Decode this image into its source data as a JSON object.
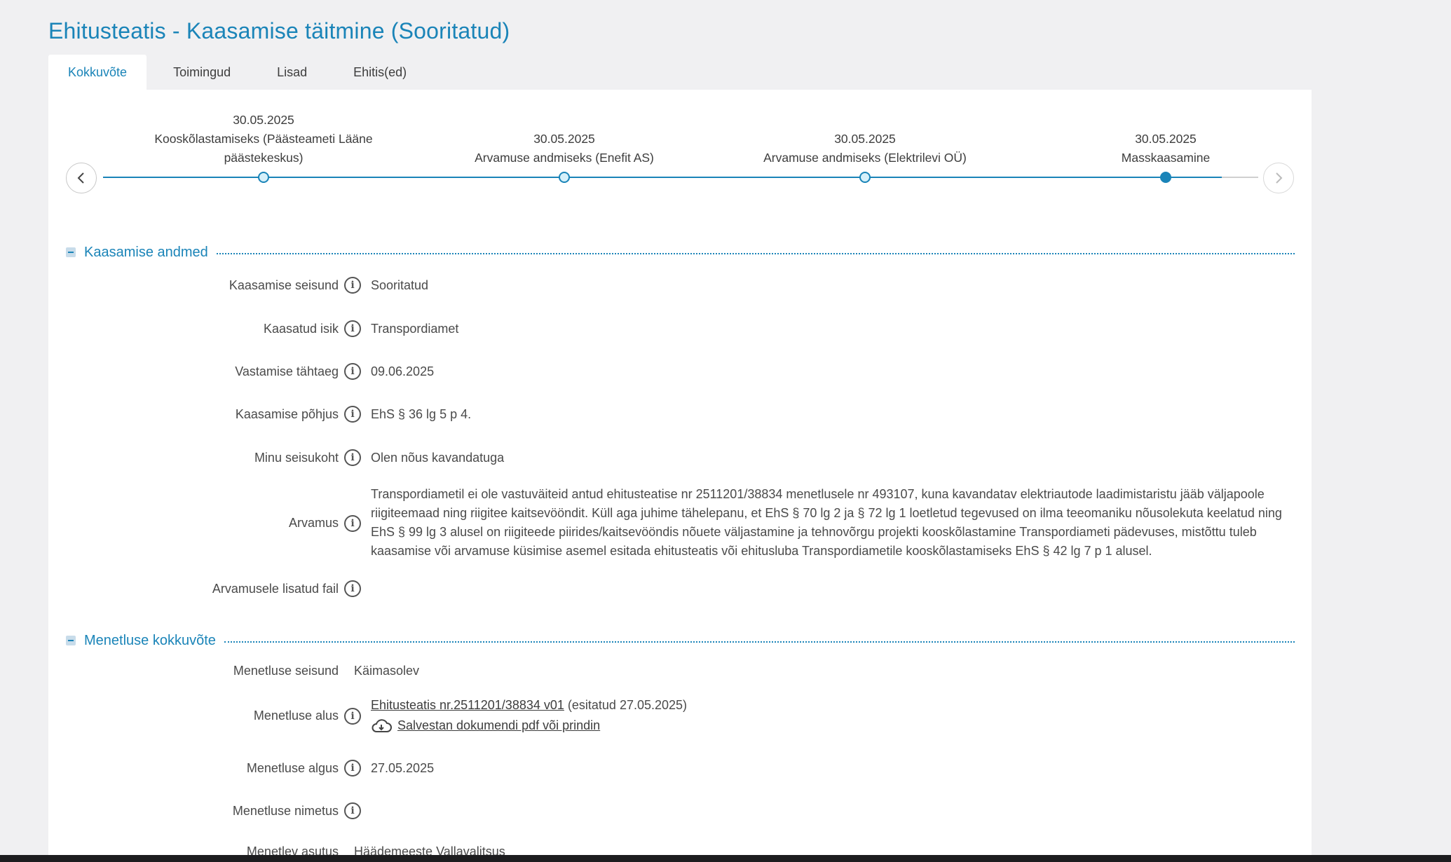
{
  "page": {
    "title": "Ehitusteatis - Kaasamise täitmine (Sooritatud)"
  },
  "tabs": [
    {
      "label": "Kokkuvõte",
      "active": true
    },
    {
      "label": "Toimingud",
      "active": false
    },
    {
      "label": "Lisad",
      "active": false
    },
    {
      "label": "Ehitis(ed)",
      "active": false
    }
  ],
  "timeline": {
    "prev_icon": "chevron-left-icon",
    "next_icon": "chevron-right-icon",
    "events": [
      {
        "date": "30.05.2025",
        "label": "Kooskõlastamiseks (Päästeameti Lääne päästekeskus)"
      },
      {
        "date": "30.05.2025",
        "label": "Arvamuse andmiseks (Enefit AS)"
      },
      {
        "date": "30.05.2025",
        "label": "Arvamuse andmiseks (Elektrilevi OÜ)"
      },
      {
        "date": "30.05.2025",
        "label": "Masskaasamine",
        "current": true
      }
    ]
  },
  "kaasamise": {
    "title": "Kaasamise andmed",
    "rows": [
      {
        "label": "Kaasamise seisund",
        "value": "Sooritatud"
      },
      {
        "label": "Kaasatud isik",
        "value": "Transpordiamet"
      },
      {
        "label": "Vastamise tähtaeg",
        "value": "09.06.2025"
      },
      {
        "label": "Kaasamise põhjus",
        "value": "EhS § 36 lg 5 p 4."
      },
      {
        "label": "Minu seisukoht",
        "value": "Olen nõus kavandatuga"
      },
      {
        "label": "Arvamus",
        "value": "Transpordiametil ei ole vastuväiteid antud ehitusteatise nr 2511201/38834 menetlusele nr 493107, kuna kavandatav elektriautode laadimistaristu jääb väljapoole riigiteemaad ning riigitee kaitsevööndit. Küll aga juhime tähelepanu, et EhS § 70 lg 2 ja § 72 lg 1 loetletud tegevused on ilma teeomaniku nõusolekuta keelatud ning EhS § 99 lg 3 alusel on riigiteede piirides/kaitsevööndis nõuete väljastamine ja tehnovõrgu projekti kooskõlastamine Transpordiameti pädevuses, mistõttu tuleb kaasamise või arvamuse küsimise asemel esitada ehitusteatis või ehitusluba Transpordiametile kooskõlastamiseks EhS § 42 lg 7 p 1 alusel."
      },
      {
        "label": "Arvamusele lisatud fail",
        "value": ""
      }
    ]
  },
  "menetlus": {
    "title": "Menetluse kokkuvõte",
    "seisund_label": "Menetluse seisund",
    "seisund_value": "Käimasolev",
    "alus_label": "Menetluse alus",
    "alus_link": "Ehitusteatis nr.2511201/38834 v01",
    "alus_submitted": "(esitatud 27.05.2025)",
    "download_link": "Salvestan dokumendi pdf või prindin",
    "download_icon": "cloud-download-icon",
    "algus_label": "Menetluse algus",
    "algus_value": "27.05.2025",
    "nimetus_label": "Menetluse nimetus",
    "nimetus_value": "",
    "asutus_label": "Menetlev asutus",
    "asutus_value": "Häädemeeste Vallavalitsus"
  },
  "colors": {
    "accent": "#1a84b8",
    "background": "#f0f0f2",
    "card": "#ffffff"
  }
}
